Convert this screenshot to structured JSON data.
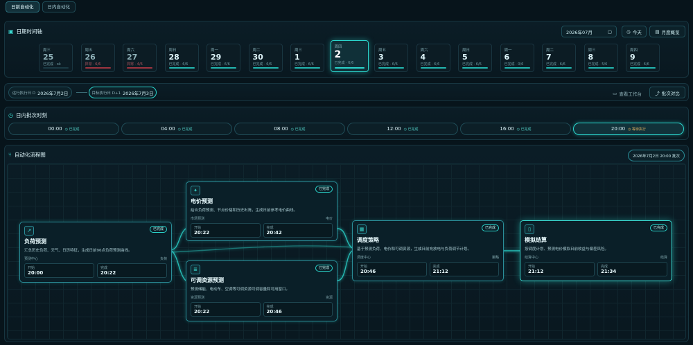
{
  "top_tabs": [
    "日前自动化",
    "日内自动化"
  ],
  "calendar": {
    "title": "日期时间轴",
    "month": "2026年07月",
    "today_btn": "今天",
    "month_btn": "月度概览",
    "days": [
      {
        "wd": "周三",
        "d": "25",
        "st": "已完成 · ok"
      },
      {
        "wd": "周五",
        "d": "26",
        "st": "异常 · 6/6"
      },
      {
        "wd": "周六",
        "d": "27",
        "st": "异常 · 4/6"
      },
      {
        "wd": "周日",
        "d": "28",
        "st": "已完成 · 6/6"
      },
      {
        "wd": "周一",
        "d": "29",
        "st": "已完成 · 6/6"
      },
      {
        "wd": "周二",
        "d": "30",
        "st": "已完成 · 6/6"
      },
      {
        "wd": "周三",
        "d": "1",
        "st": "已完成 · 6/6"
      },
      {
        "wd": "周四",
        "d": "2",
        "st": "已完成 · 6/6"
      },
      {
        "wd": "周五",
        "d": "3",
        "st": "已完成 · 6/6"
      },
      {
        "wd": "周六",
        "d": "4",
        "st": "已完成 · 6/6"
      },
      {
        "wd": "周日",
        "d": "5",
        "st": "已完成 · 6/6"
      },
      {
        "wd": "周一",
        "d": "6",
        "st": "已完成 · 0/6"
      },
      {
        "wd": "周二",
        "d": "7",
        "st": "已完成 · 6/6"
      },
      {
        "wd": "周三",
        "d": "8",
        "st": "已完成 · 5/6"
      },
      {
        "wd": "周四",
        "d": "9",
        "st": "已完成 · 6/6"
      }
    ]
  },
  "run_bar": {
    "run_label": "运行执行日 D",
    "run_date": "2026年7月2日",
    "target_label": "目标执行日 D+1",
    "target_date": "2026年7月3日",
    "workbench_btn": "查看工作台",
    "compare_btn": "批次对比"
  },
  "intraday": {
    "title": "日内批次时刻",
    "slots": [
      {
        "t": "00:00",
        "s": "◷ 已完成"
      },
      {
        "t": "04:00",
        "s": "◷ 已完成"
      },
      {
        "t": "08:00",
        "s": "◷ 已完成"
      },
      {
        "t": "12:00",
        "s": "◷ 已完成"
      },
      {
        "t": "16:00",
        "s": "◷ 已完成"
      },
      {
        "t": "20:00",
        "s": "◷ 等待执行"
      }
    ]
  },
  "flow": {
    "title": "自动化流程图",
    "batch": "2026年7月2日 20:00 批次",
    "nodes": {
      "load": {
        "title": "负荷预测",
        "badge": "已完成",
        "desc": "汇总历史负荷、天气、日历特征，生成日前96点负荷预测曲线。",
        "org": "预测中心",
        "tag": "负荷",
        "start_l": "开始",
        "start": "20:00",
        "end_l": "完成",
        "end": "20:22"
      },
      "price": {
        "title": "电价预测",
        "badge": "已完成",
        "desc": "结合负荷预测、节点价格和历史出清，生成日前参考电价曲线。",
        "org": "市场预测",
        "tag": "电价",
        "start_l": "开始",
        "start": "20:22",
        "end_l": "完成",
        "end": "20:42"
      },
      "resource": {
        "title": "可调资源预测",
        "badge": "已完成",
        "desc": "预测储能、电动车、空调等可调资源可调容量和可用窗口。",
        "org": "资源预测",
        "tag": "资源",
        "start_l": "开始",
        "start": "20:22",
        "end_l": "完成",
        "end": "20:46"
      },
      "dispatch": {
        "title": "调度策略",
        "badge": "已完成",
        "desc": "基于预测负荷、电价和可调资源，生成日前充放电与负荷调节计划。",
        "org": "调度中心",
        "tag": "策略",
        "start_l": "开始",
        "start": "20:46",
        "end_l": "完成",
        "end": "21:12"
      },
      "settle": {
        "title": "模拟结算",
        "badge": "已完成",
        "desc": "按调度计划、预测电价模拟日前收益与偏差风险。",
        "org": "结算中心",
        "tag": "结算",
        "start_l": "开始",
        "start": "21:12",
        "end_l": "完成",
        "end": "21:34"
      }
    }
  }
}
